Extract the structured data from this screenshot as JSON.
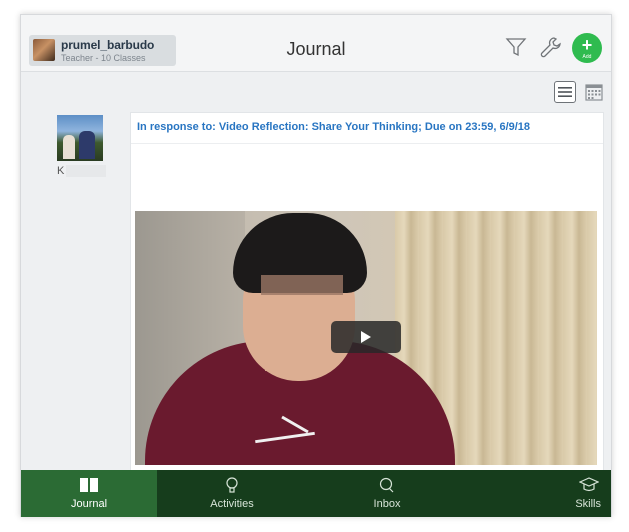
{
  "header": {
    "user_name": "prumel_barbudo",
    "user_subtitle": "Teacher - 10 Classes",
    "title": "Journal",
    "add_label": "Add"
  },
  "author": {
    "initial": "K"
  },
  "entry": {
    "response_text": "In response to: Video Reflection: Share Your Thinking; Due on 23:59, 6/9/18"
  },
  "tabs": [
    {
      "label": "Journal",
      "icon": "book-icon",
      "active": true
    },
    {
      "label": "Activities",
      "icon": "lightbulb-icon",
      "active": false
    },
    {
      "label": "Inbox",
      "icon": "chat-icon",
      "active": false
    },
    {
      "label": "Skills",
      "icon": "graduation-cap-icon",
      "active": false
    }
  ],
  "colors": {
    "tabbar": "#163d1c",
    "tab_active": "#2b6b34",
    "add_button": "#2fbb4f",
    "link": "#2875c2"
  }
}
